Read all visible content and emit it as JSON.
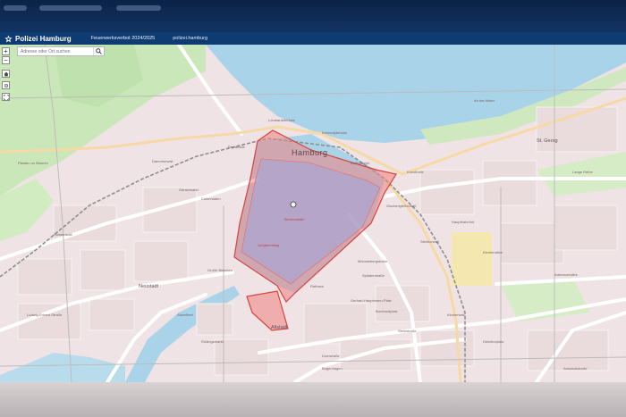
{
  "window": {
    "top_tabs": [
      "",
      "",
      ""
    ]
  },
  "header": {
    "brand": "Polizei Hamburg",
    "subtitle": "Feuerwerksverbot 2024/2025",
    "link": "polizei.hamburg"
  },
  "search": {
    "placeholder": "Adresse oder Ort suchen",
    "value": ""
  },
  "controls": {
    "zoom_in": "+",
    "zoom_out": "−"
  },
  "map": {
    "labels": {
      "hamburg": "Hamburg",
      "neustadt": "Neustadt",
      "altstadt": "Altstadt",
      "binnenalster": "Binnenalster",
      "jungfernstieg": "Jungfernstieg",
      "rathaus": "Rathaus",
      "lombardsbrucke": "Lombardsbrücke",
      "kennedybrucke": "Kennedybrücke",
      "ballindamm": "Ballindamm",
      "glockengiesserwall": "Glockengießerwall",
      "steintorwall": "Steintorwall",
      "monckebergstrasse": "Mönckebergstraße",
      "spitalerstrasse": "Spitalerstraße",
      "gerhart_hauptmann_platz": "Gerhart-Hauptmann-Platz",
      "fehlandtstrasse": "Fehlandtstraße",
      "colonnaden": "Colonnaden",
      "gaensemarkt": "Gänsemarkt",
      "dammtor": "Dammtorwall",
      "esplanade": "Esplanade",
      "grosse_bleichen": "Große Bleichen",
      "alsterfleet": "Alsterfleet",
      "burchardplatz": "Burchardplatz",
      "steinstrasse": "Steinstraße",
      "kunsthalle": "Kunsthalle",
      "hauptbahnhof": "Hauptbahnhof",
      "adenauerallee": "Adenauerallee",
      "st_georg": "St. Georg",
      "holstenwall": "Holstenwall",
      "planten": "Planten un Blomen",
      "ludwig_erhard": "Ludwig-Erhard-Straße",
      "rodingsmarkt": "Rödingsmarkt",
      "domstrasse": "Domstraße",
      "an_der_alster": "An der Alster",
      "lange_reihe": "Lange Reihe",
      "kirchenallee": "Kirchenallee",
      "bugenhagen": "Bugenhagen",
      "deichtorplatz": "Deichtorplatz",
      "klosterwall": "Klosterwall",
      "amsinck": "Amsinckstraße"
    }
  },
  "colors": {
    "header": "#0f3b73",
    "water": "#a9d3e9",
    "park": "#c8e6b7",
    "zone_fill": "#f08c8c",
    "zone_stroke": "#d8433c",
    "alster_fill": "#b7a7cc",
    "street": "#ffffff",
    "rail": "#9a9a9a"
  }
}
